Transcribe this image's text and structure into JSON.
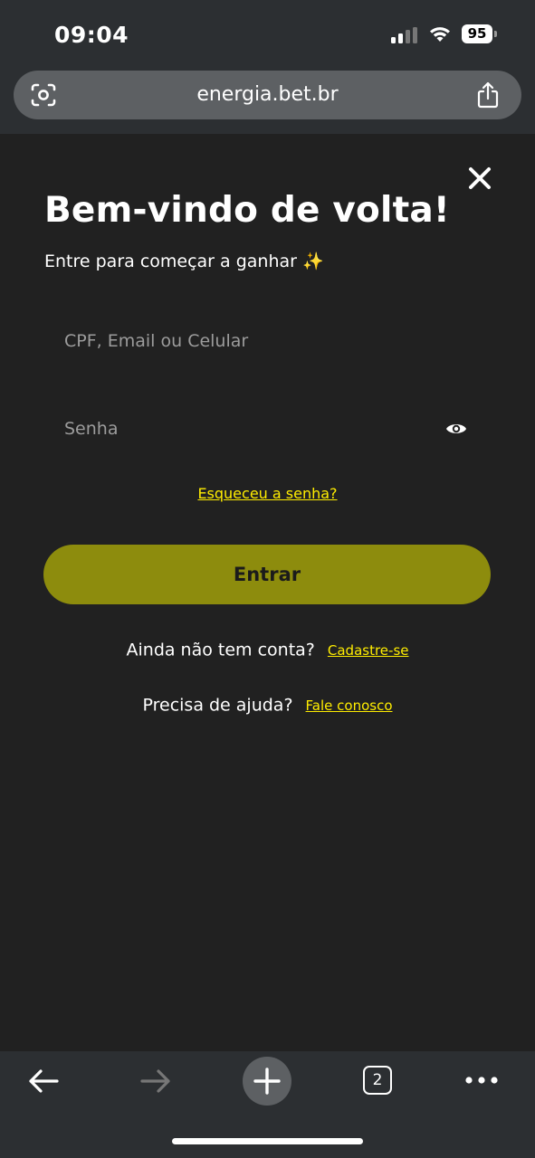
{
  "status_bar": {
    "time": "09:04",
    "battery": "95"
  },
  "browser": {
    "url": "energia.bet.br"
  },
  "login": {
    "title": "Bem-vindo de volta!",
    "subtitle": "Entre para começar a ganhar",
    "subtitle_emoji": "✨",
    "login_placeholder": "CPF, Email ou Celular",
    "password_placeholder": "Senha",
    "forgot_link": "Esqueceu a senha?",
    "submit_label": "Entrar",
    "signup_question": "Ainda não tem conta?",
    "signup_link": "Cadastre-se",
    "help_question": "Precisa de ajuda?",
    "help_link": "Fale conosco"
  },
  "toolbar": {
    "tab_count": "2"
  },
  "colors": {
    "accent": "#ffed00",
    "button": "#8d8c0d",
    "background": "#212121"
  }
}
